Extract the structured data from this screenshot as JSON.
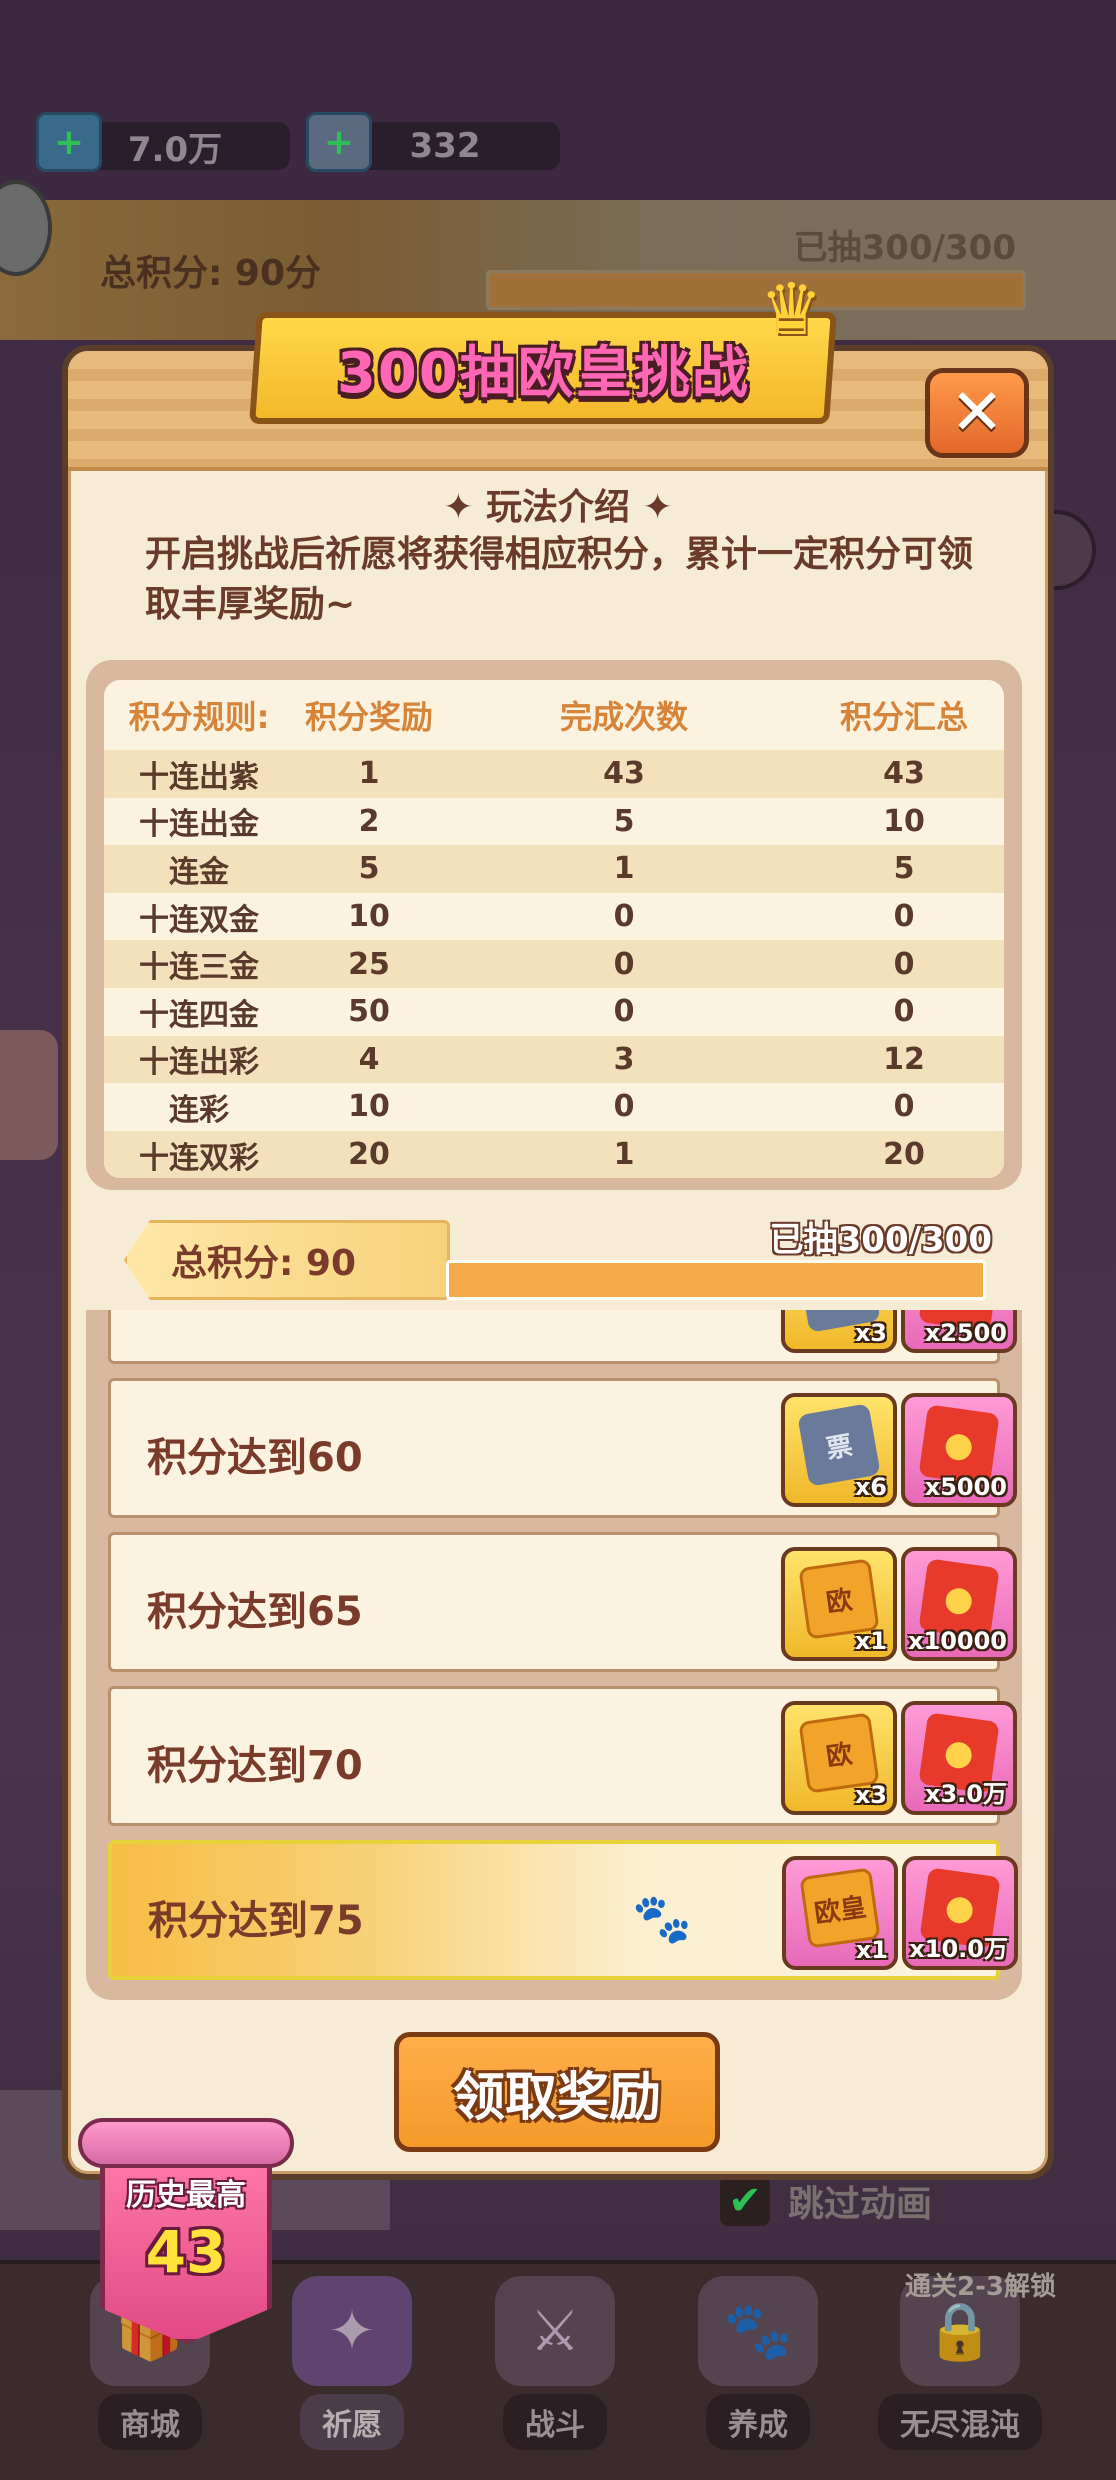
{
  "top_resources": [
    {
      "icon": "gem-plus-icon",
      "value": "7.0万"
    },
    {
      "icon": "ticket-plus-icon",
      "value": "332"
    }
  ],
  "header": {
    "total_score": "总积分: 90分",
    "drawn": "已抽300/300"
  },
  "modal": {
    "title": "300抽欧皇挑战",
    "close_symbol": "✕",
    "intro_title": "✦ 玩法介绍 ✦",
    "intro_text": "开启挑战后祈愿将获得相应积分，累计一定积分可领取丰厚奖励~"
  },
  "rules": {
    "headers": [
      "积分规则:",
      "积分奖励",
      "完成次数",
      "积分汇总"
    ],
    "rows": [
      {
        "rule": "十连出紫",
        "reward": "1",
        "count": "43",
        "total": "43"
      },
      {
        "rule": "十连出金",
        "reward": "2",
        "count": "5",
        "total": "10"
      },
      {
        "rule": "连金",
        "reward": "5",
        "count": "1",
        "total": "5"
      },
      {
        "rule": "十连双金",
        "reward": "10",
        "count": "0",
        "total": "0"
      },
      {
        "rule": "十连三金",
        "reward": "25",
        "count": "0",
        "total": "0"
      },
      {
        "rule": "十连四金",
        "reward": "50",
        "count": "0",
        "total": "0"
      },
      {
        "rule": "十连出彩",
        "reward": "4",
        "count": "3",
        "total": "12"
      },
      {
        "rule": "连彩",
        "reward": "10",
        "count": "0",
        "total": "0"
      },
      {
        "rule": "十连双彩",
        "reward": "20",
        "count": "1",
        "total": "20"
      }
    ]
  },
  "progress": {
    "total_label": "总积分: 90",
    "drawn_label": "已抽300/300",
    "fraction": 1.0
  },
  "rewards": [
    {
      "label": "",
      "items": [
        {
          "type": "ticket",
          "qty": "x3"
        },
        {
          "type": "redpack",
          "qty": "x2500"
        }
      ]
    },
    {
      "label": "积分达到60",
      "items": [
        {
          "type": "ticket",
          "qty": "x6"
        },
        {
          "type": "redpack",
          "qty": "x5000"
        }
      ]
    },
    {
      "label": "积分达到65",
      "items": [
        {
          "type": "scroll",
          "qty": "x1"
        },
        {
          "type": "redpack",
          "qty": "x10000"
        }
      ]
    },
    {
      "label": "积分达到70",
      "items": [
        {
          "type": "scroll",
          "qty": "x3"
        },
        {
          "type": "redpack",
          "qty": "x3.0万"
        }
      ]
    },
    {
      "label": "积分达到75",
      "items": [
        {
          "type": "scroll-pink",
          "qty": "x1"
        },
        {
          "type": "redpack",
          "qty": "x10.0万"
        }
      ]
    }
  ],
  "claim_button": "领取奖励",
  "history_best": {
    "label": "历史最高",
    "value": "43"
  },
  "skip_animation": "跳过动画",
  "unlock_tip": "通关2-3解锁",
  "nav": [
    {
      "label": "商城",
      "icon": "gift-icon"
    },
    {
      "label": "祈愿",
      "icon": "card-icon"
    },
    {
      "label": "战斗",
      "icon": "swords-icon"
    },
    {
      "label": "养成",
      "icon": "paw-icon"
    },
    {
      "label": "无尽混沌",
      "icon": "lock-icon"
    }
  ]
}
